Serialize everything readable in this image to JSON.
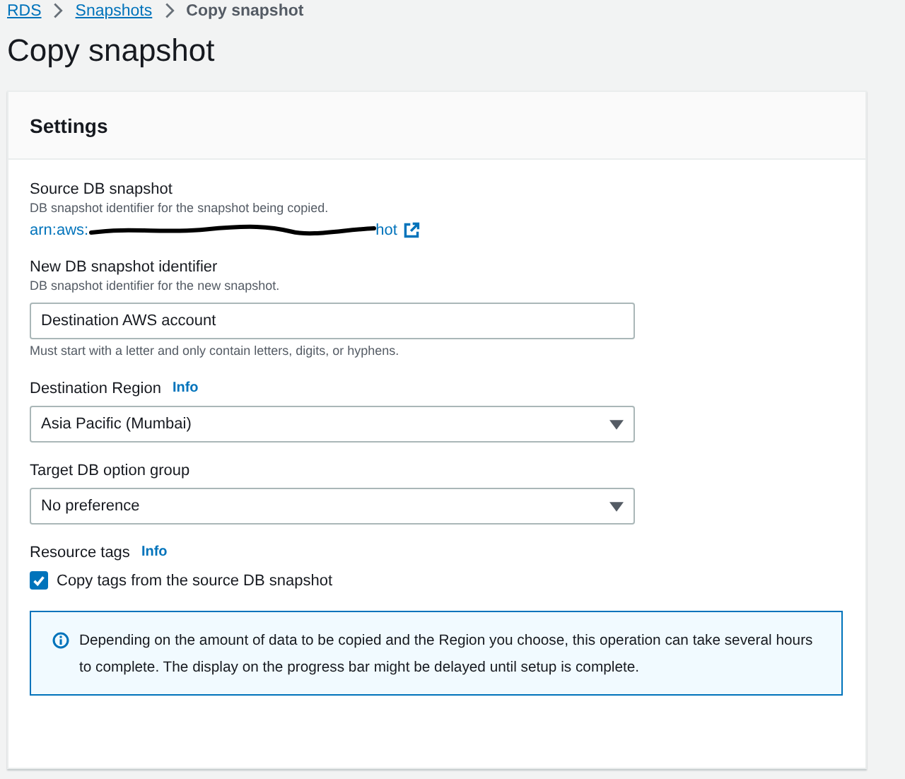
{
  "breadcrumbs": [
    {
      "label": "RDS",
      "kind": "link"
    },
    {
      "label": "Snapshots",
      "kind": "link"
    },
    {
      "label": "Copy snapshot",
      "kind": "current"
    }
  ],
  "title": "Copy snapshot",
  "panel": {
    "title": "Settings",
    "source": {
      "label": "Source DB snapshot",
      "description": "DB snapshot identifier for the snapshot being copied.",
      "link_start": "arn:aws:",
      "link_end": "hot",
      "redacted": true
    },
    "identifier": {
      "label": "New DB snapshot identifier",
      "description": "DB snapshot identifier for the new snapshot.",
      "value": "Destination AWS account",
      "constraint": "Must start with a letter and only contain letters, digits, or hyphens."
    },
    "region": {
      "label": "Destination Region",
      "info": "Info",
      "value": "Asia Pacific (Mumbai)"
    },
    "option_group": {
      "label": "Target DB option group",
      "value": "No preference"
    },
    "tags": {
      "label": "Resource tags",
      "info": "Info",
      "checkbox": {
        "label": "Copy tags from the source DB snapshot",
        "checked": true
      }
    },
    "alert": "Depending on the amount of data to be copied and the Region you choose, this operation can take several hours to complete. The display on the progress bar might be delayed until setup is complete."
  }
}
